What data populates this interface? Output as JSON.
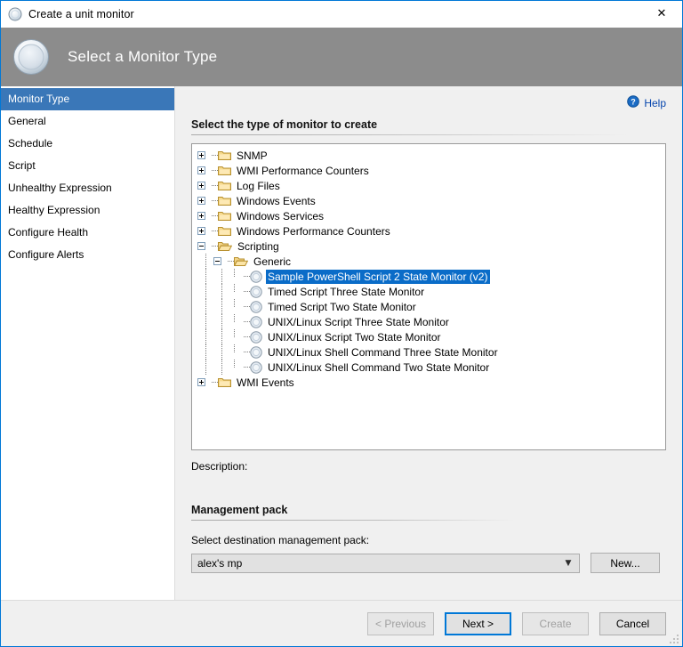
{
  "window": {
    "title": "Create a unit monitor",
    "title_icon": "monitor-circle-icon",
    "close_label": "✕"
  },
  "header": {
    "title": "Select a Monitor Type",
    "icon": "monitor-circle-large-icon"
  },
  "sidebar": {
    "items": [
      {
        "label": "Monitor Type",
        "selected": true
      },
      {
        "label": "General",
        "selected": false
      },
      {
        "label": "Schedule",
        "selected": false
      },
      {
        "label": "Script",
        "selected": false
      },
      {
        "label": "Unhealthy Expression",
        "selected": false
      },
      {
        "label": "Healthy Expression",
        "selected": false
      },
      {
        "label": "Configure Health",
        "selected": false
      },
      {
        "label": "Configure Alerts",
        "selected": false
      }
    ]
  },
  "help": {
    "label": "Help",
    "icon": "help-question-icon"
  },
  "main": {
    "section_title": "Select the type of monitor to create",
    "description_label": "Description:",
    "description_value": "",
    "tree": [
      {
        "label": "SNMP",
        "depth": 0,
        "type": "folder-closed",
        "expander": "plus",
        "selected": false
      },
      {
        "label": "WMI Performance Counters",
        "depth": 0,
        "type": "folder-closed",
        "expander": "plus",
        "selected": false
      },
      {
        "label": "Log Files",
        "depth": 0,
        "type": "folder-closed",
        "expander": "plus",
        "selected": false
      },
      {
        "label": "Windows Events",
        "depth": 0,
        "type": "folder-closed",
        "expander": "plus",
        "selected": false
      },
      {
        "label": "Windows Services",
        "depth": 0,
        "type": "folder-closed",
        "expander": "plus",
        "selected": false
      },
      {
        "label": "Windows Performance Counters",
        "depth": 0,
        "type": "folder-closed",
        "expander": "plus",
        "selected": false
      },
      {
        "label": "Scripting",
        "depth": 0,
        "type": "folder-open",
        "expander": "minus",
        "selected": false
      },
      {
        "label": "Generic",
        "depth": 1,
        "type": "folder-open",
        "expander": "minus",
        "selected": false
      },
      {
        "label": "Sample PowerShell Script 2 State Monitor (v2)",
        "depth": 2,
        "type": "monitor",
        "expander": "none",
        "selected": true
      },
      {
        "label": "Timed Script Three State Monitor",
        "depth": 2,
        "type": "monitor",
        "expander": "none",
        "selected": false
      },
      {
        "label": "Timed Script Two State Monitor",
        "depth": 2,
        "type": "monitor",
        "expander": "none",
        "selected": false
      },
      {
        "label": "UNIX/Linux Script Three State Monitor",
        "depth": 2,
        "type": "monitor",
        "expander": "none",
        "selected": false
      },
      {
        "label": "UNIX/Linux Script Two State Monitor",
        "depth": 2,
        "type": "monitor",
        "expander": "none",
        "selected": false
      },
      {
        "label": "UNIX/Linux Shell Command Three State Monitor",
        "depth": 2,
        "type": "monitor",
        "expander": "none",
        "selected": false
      },
      {
        "label": "UNIX/Linux Shell Command Two State Monitor",
        "depth": 2,
        "type": "monitor",
        "expander": "none",
        "selected": false
      },
      {
        "label": "WMI Events",
        "depth": 0,
        "type": "folder-closed",
        "expander": "plus",
        "selected": false
      }
    ]
  },
  "management_pack": {
    "section_title": "Management pack",
    "select_label": "Select destination management pack:",
    "selected_value": "alex's mp",
    "new_button": "New..."
  },
  "footer": {
    "buttons": [
      {
        "label": "< Previous",
        "state": "disabled"
      },
      {
        "label": "Next >",
        "state": "focused"
      },
      {
        "label": "Create",
        "state": "disabled"
      },
      {
        "label": "Cancel",
        "state": "normal"
      }
    ]
  },
  "colors": {
    "accent": "#0078d7",
    "selection": "#0a6cc8",
    "nav_selection": "#3a77b8",
    "header_band": "#8c8c8c",
    "content_bg": "#f0f0f0",
    "link": "#0645ad"
  }
}
